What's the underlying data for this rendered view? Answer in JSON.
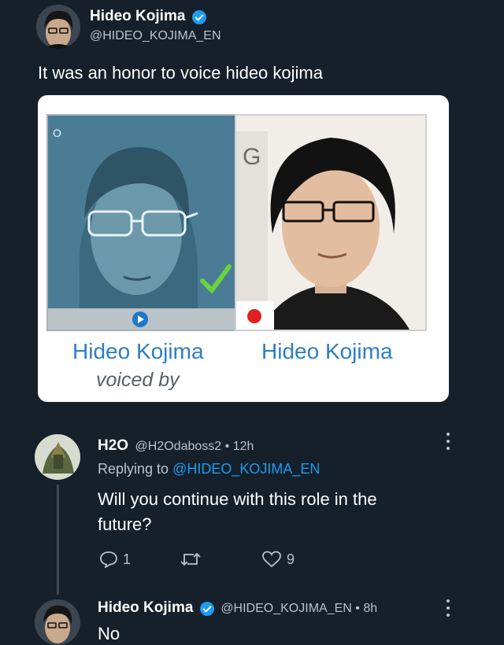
{
  "main_tweet": {
    "author_name": "Hideo Kojima",
    "author_handle": "@HIDEO_KOJIMA_EN",
    "text": "It was an honor to voice hideo kojima"
  },
  "meme": {
    "left_name": "Hideo Kojima",
    "right_name": "Hideo Kojima",
    "caption": "voiced by",
    "corner_letter": "O",
    "sign_letters": "G"
  },
  "reply": {
    "author_name": "H2O",
    "author_handle": "@H2Odaboss2",
    "separator": "•",
    "time": "12h",
    "replying_to_label": "Replying to",
    "replying_to_handle": "@HIDEO_KOJIMA_EN",
    "text": "Will you continue with this role in the future?",
    "reply_count": "1",
    "retweet_count": "",
    "like_count": "9"
  },
  "second_reply": {
    "author_name": "Hideo Kojima",
    "author_handle": "@HIDEO_KOJIMA_EN",
    "separator": "•",
    "time": "8h",
    "text": "No"
  },
  "colors": {
    "background": "#15202b",
    "accent": "#1d9bf0",
    "muted": "#b9c3cc",
    "card_name": "#2d7fc3"
  },
  "icons": [
    "verified-badge-icon",
    "more-icon",
    "reply-icon",
    "retweet-icon",
    "like-icon",
    "play-icon",
    "checkmark-icon",
    "japan-flag-icon"
  ]
}
